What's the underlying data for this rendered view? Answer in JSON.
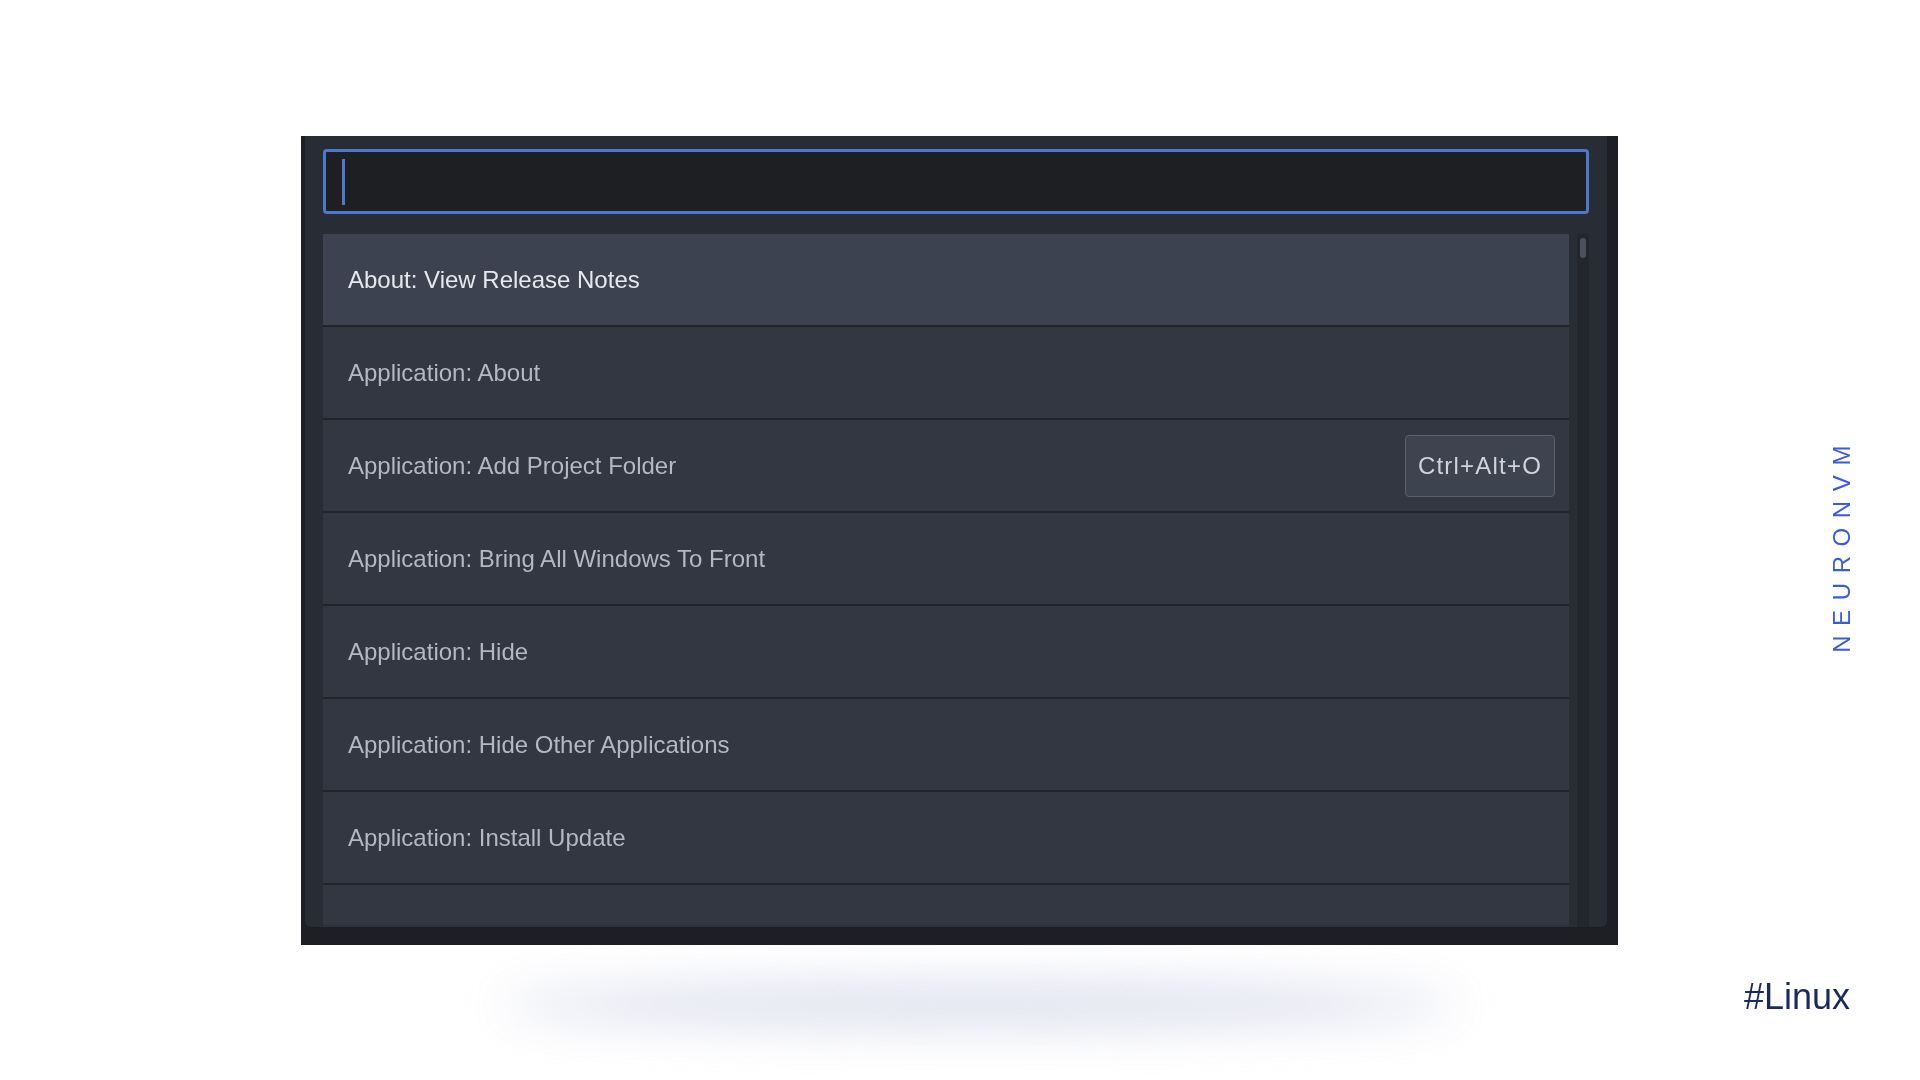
{
  "command_palette": {
    "items": [
      {
        "label": "About: View Release Notes",
        "selected": true
      },
      {
        "label": "Application: About",
        "selected": false
      },
      {
        "label": "Application: Add Project Folder",
        "selected": false,
        "keybinding": "Ctrl+Alt+O"
      },
      {
        "label": "Application: Bring All Windows To Front",
        "selected": false
      },
      {
        "label": "Application: Hide",
        "selected": false
      },
      {
        "label": "Application: Hide Other Applications",
        "selected": false
      },
      {
        "label": "Application: Install Update",
        "selected": false
      }
    ]
  },
  "brand": "NEURONVM",
  "tag": "#Linux"
}
